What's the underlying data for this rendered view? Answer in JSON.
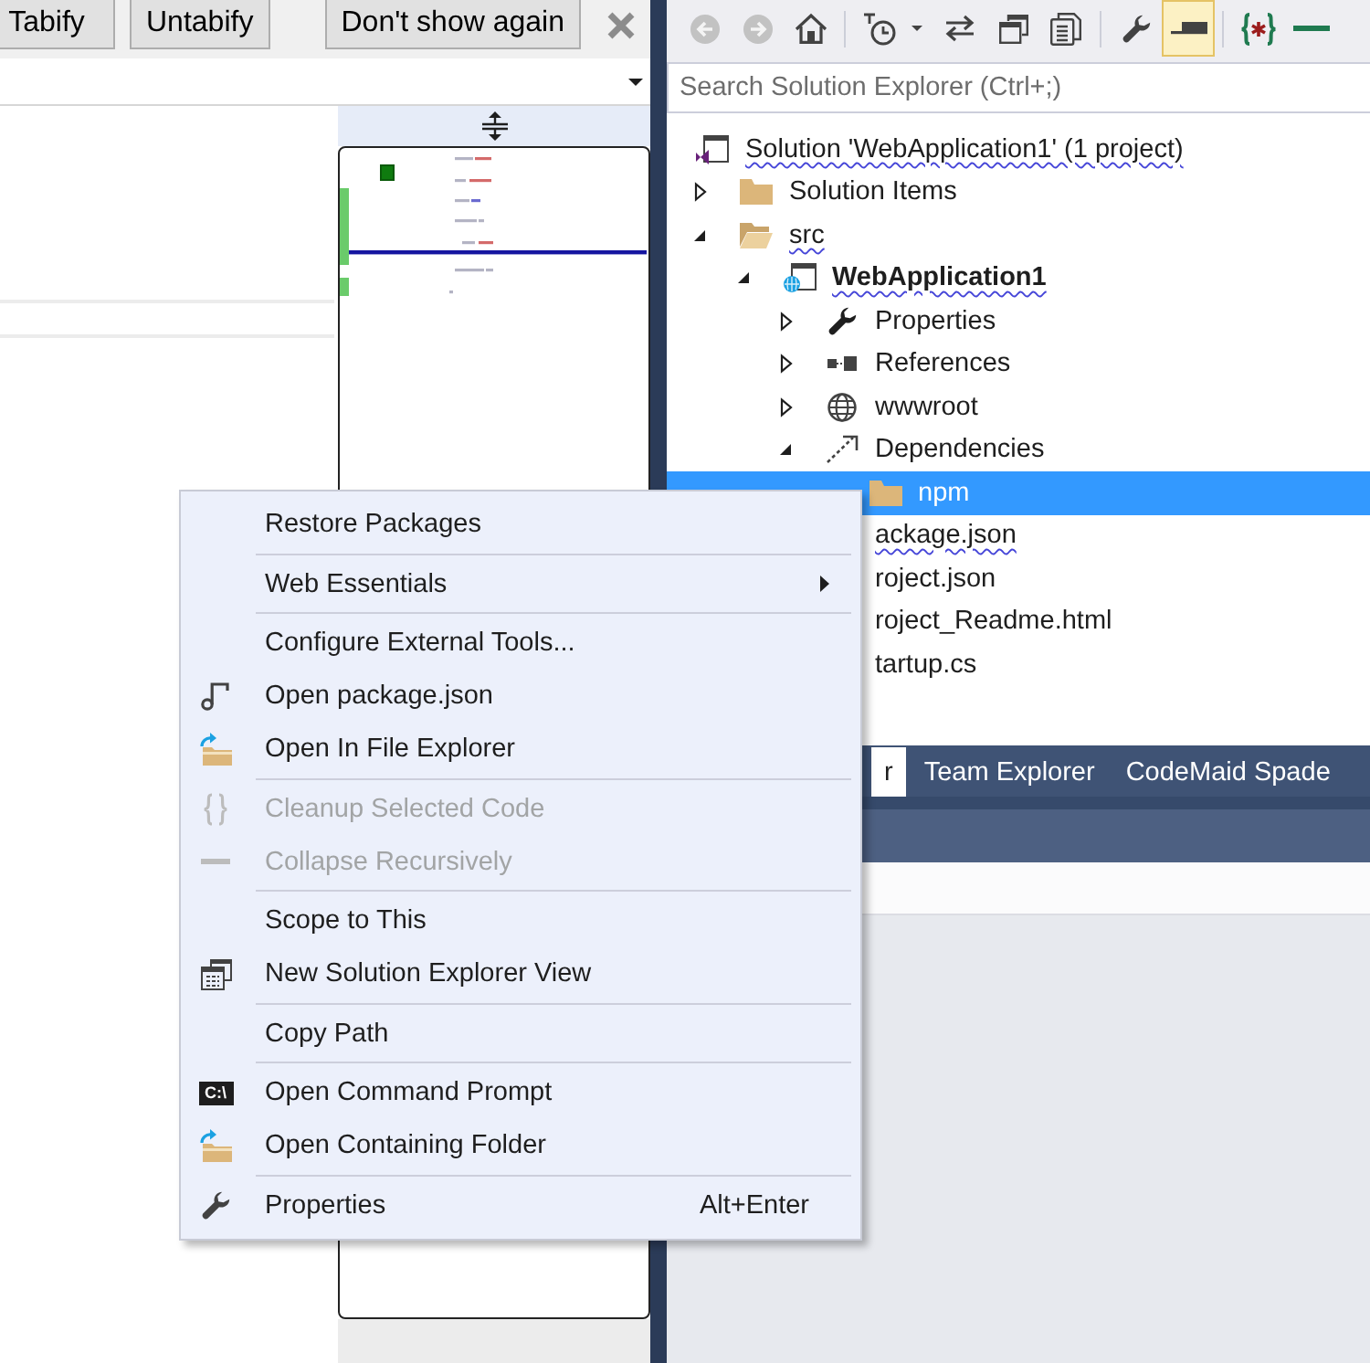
{
  "editor_infobar": {
    "buttons": [
      "Tabify",
      "Untabify",
      "Don't show again"
    ]
  },
  "solution_explorer": {
    "toolbar": [
      [
        {
          "kind": "back",
          "disabled": true,
          "on": false
        },
        {
          "kind": "forward",
          "disabled": true,
          "on": false
        },
        {
          "kind": "home",
          "disabled": false,
          "on": false
        }
      ],
      [
        {
          "kind": "pending-changes",
          "disabled": false,
          "on": false
        },
        {
          "kind": "sync",
          "disabled": false,
          "on": false
        },
        {
          "kind": "collapse-all",
          "disabled": false,
          "on": false
        },
        {
          "kind": "show-all-files",
          "disabled": false,
          "on": false
        }
      ],
      [
        {
          "kind": "properties",
          "disabled": false,
          "on": false
        },
        {
          "kind": "preview",
          "disabled": false,
          "on": true
        }
      ],
      [
        {
          "kind": "braces",
          "disabled": false,
          "on": false
        },
        {
          "kind": "minus",
          "disabled": false,
          "on": false
        }
      ]
    ],
    "search": {
      "placeholder": "Search Solution Explorer (Ctrl+;)"
    },
    "tree": [
      {
        "label": "Solution 'WebApplication1' (1 project)",
        "kind": "solution",
        "selected": false,
        "bold": false,
        "squiggle": true,
        "children": [
          {
            "label": "Solution Items",
            "kind": "folder",
            "expanded": false,
            "selected": false,
            "bold": false,
            "squiggle": false
          },
          {
            "label": "src",
            "kind": "open-folder",
            "expanded": true,
            "selected": false,
            "bold": false,
            "squiggle": true,
            "children": [
              {
                "label": "WebApplication1",
                "kind": "web-project",
                "expanded": true,
                "selected": false,
                "bold": true,
                "squiggle": true,
                "children": [
                  {
                    "label": "Properties",
                    "kind": "properties",
                    "expanded": false,
                    "selected": false,
                    "bold": false,
                    "squiggle": false
                  },
                  {
                    "label": "References",
                    "kind": "references",
                    "expanded": false,
                    "selected": false,
                    "bold": false,
                    "squiggle": false
                  },
                  {
                    "label": "wwwroot",
                    "kind": "web-root",
                    "expanded": false,
                    "selected": false,
                    "bold": false,
                    "squiggle": false
                  },
                  {
                    "label": "Dependencies",
                    "kind": "dependencies",
                    "expanded": true,
                    "selected": false,
                    "bold": false,
                    "squiggle": false,
                    "children": [
                      {
                        "label": "npm",
                        "kind": "folder",
                        "selected": true,
                        "bold": false,
                        "squiggle": false
                      }
                    ]
                  },
                  {
                    "label": "ackage.json",
                    "kind": "file",
                    "selected": false,
                    "bold": false,
                    "squiggle": true
                  },
                  {
                    "label": "roject.json",
                    "kind": "file",
                    "selected": false,
                    "bold": false,
                    "squiggle": false
                  },
                  {
                    "label": "roject_Readme.html",
                    "kind": "file",
                    "selected": false,
                    "bold": false,
                    "squiggle": false
                  },
                  {
                    "label": "tartup.cs",
                    "kind": "file",
                    "selected": false,
                    "bold": false,
                    "squiggle": false
                  }
                ]
              }
            ]
          }
        ]
      }
    ]
  },
  "tool_tabs": [
    {
      "label": "r",
      "selected": true
    },
    {
      "label": "Team Explorer",
      "selected": false
    },
    {
      "label": "CodeMaid Spade",
      "selected": false
    }
  ],
  "context_menu": {
    "groups": [
      [
        {
          "label": "Restore Packages",
          "kind": "text",
          "disabled": false
        }
      ],
      [
        {
          "label": "Web Essentials",
          "kind": "text",
          "disabled": false,
          "submenu": true
        }
      ],
      [
        {
          "label": "Configure External Tools...",
          "kind": "text",
          "disabled": false
        },
        {
          "label": "Open package.json",
          "kind": "package-file",
          "disabled": false
        },
        {
          "label": "Open In File Explorer",
          "kind": "folder-arrow",
          "disabled": false
        }
      ],
      [
        {
          "label": "Cleanup Selected Code",
          "kind": "braces",
          "disabled": true
        },
        {
          "label": "Collapse Recursively",
          "kind": "dash",
          "disabled": true
        }
      ],
      [
        {
          "label": "Scope to This",
          "kind": "text",
          "disabled": false
        },
        {
          "label": "New Solution Explorer View",
          "kind": "windows",
          "disabled": false
        }
      ],
      [
        {
          "label": "Copy Path",
          "kind": "text",
          "disabled": false
        }
      ],
      [
        {
          "label": "Open Command Prompt",
          "kind": "console",
          "icon_text": "C:\\",
          "disabled": false
        },
        {
          "label": "Open Containing Folder",
          "kind": "folder-arrow",
          "disabled": false
        }
      ],
      [
        {
          "label": "Properties",
          "kind": "wrench",
          "shortcut": "Alt+Enter",
          "disabled": false
        }
      ]
    ]
  }
}
